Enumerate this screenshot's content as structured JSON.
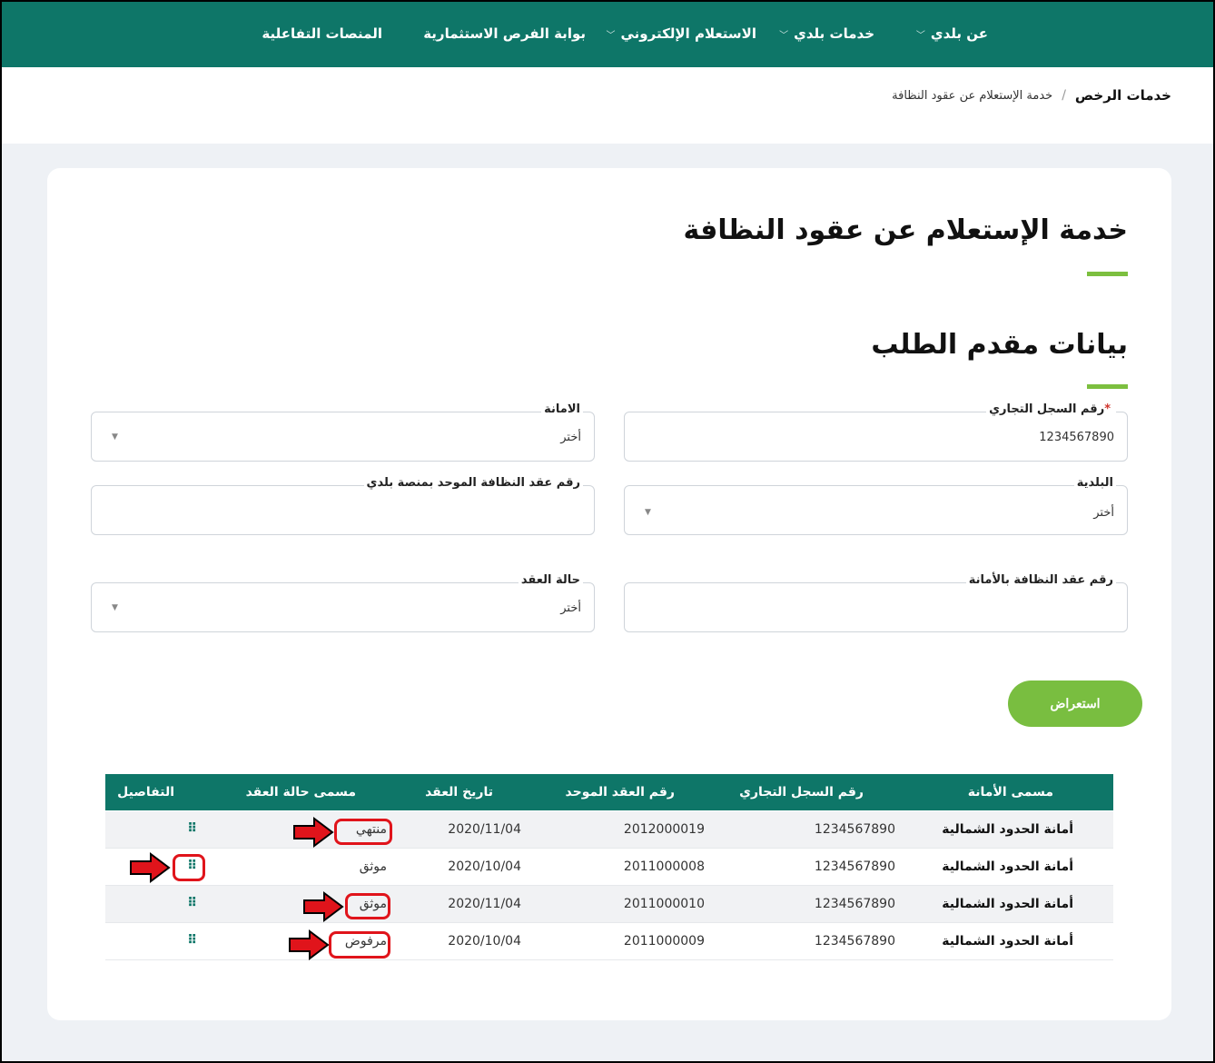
{
  "nav": {
    "items": [
      {
        "label": "عن بلدي",
        "has_dropdown": true
      },
      {
        "label": "خدمات بلدي",
        "has_dropdown": true
      },
      {
        "label": "الاستعلام الإلكتروني",
        "has_dropdown": true
      },
      {
        "label": "بوابة الفرص الاستثمارية",
        "has_dropdown": false
      },
      {
        "label": "المنصات التفاعلية",
        "has_dropdown": false
      }
    ]
  },
  "breadcrumb": {
    "root": "خدمات الرخص",
    "separator": "/",
    "current": "خدمة الإستعلام عن عقود النظافة"
  },
  "page": {
    "title": "خدمة الإستعلام عن عقود النظافة",
    "section_title": "بيانات مقدم الطلب"
  },
  "form": {
    "cr_number": {
      "label": "رقم السجل التجاري",
      "required_mark": "*",
      "value": "1234567890"
    },
    "amanah": {
      "label": "الامانة",
      "value": "أختر"
    },
    "municipality": {
      "label": "البلدية",
      "value": "أختر"
    },
    "unified_contract": {
      "label": "رقم عقد النظافة الموحد بمنصة بلدي",
      "value": ""
    },
    "amanah_contract": {
      "label": "رقم عقد النظافة بالأمانة",
      "value": ""
    },
    "contract_status": {
      "label": "حالة العقد",
      "value": "أختر"
    },
    "submit_label": "استعراض"
  },
  "table": {
    "headers": [
      "مسمى الأمانة",
      "رقم السجل التجاري",
      "رقم العقد الموحد",
      "تاريخ العقد",
      "مسمى حالة العقد",
      "التفاصيل"
    ],
    "rows": [
      {
        "amanah": "أمانة الحدود الشمالية",
        "cr": "1234567890",
        "contract": "2012000019",
        "date": "2020/11/04",
        "status": "منتهي"
      },
      {
        "amanah": "أمانة الحدود الشمالية",
        "cr": "1234567890",
        "contract": "2011000008",
        "date": "2020/10/04",
        "status": "موثق"
      },
      {
        "amanah": "أمانة الحدود الشمالية",
        "cr": "1234567890",
        "contract": "2011000010",
        "date": "2020/11/04",
        "status": "موثق"
      },
      {
        "amanah": "أمانة الحدود الشمالية",
        "cr": "1234567890",
        "contract": "2011000009",
        "date": "2020/10/04",
        "status": "مرفوض"
      }
    ]
  },
  "colors": {
    "primary": "#0e7668",
    "accent": "#79be40",
    "highlight": "#e0141b"
  }
}
